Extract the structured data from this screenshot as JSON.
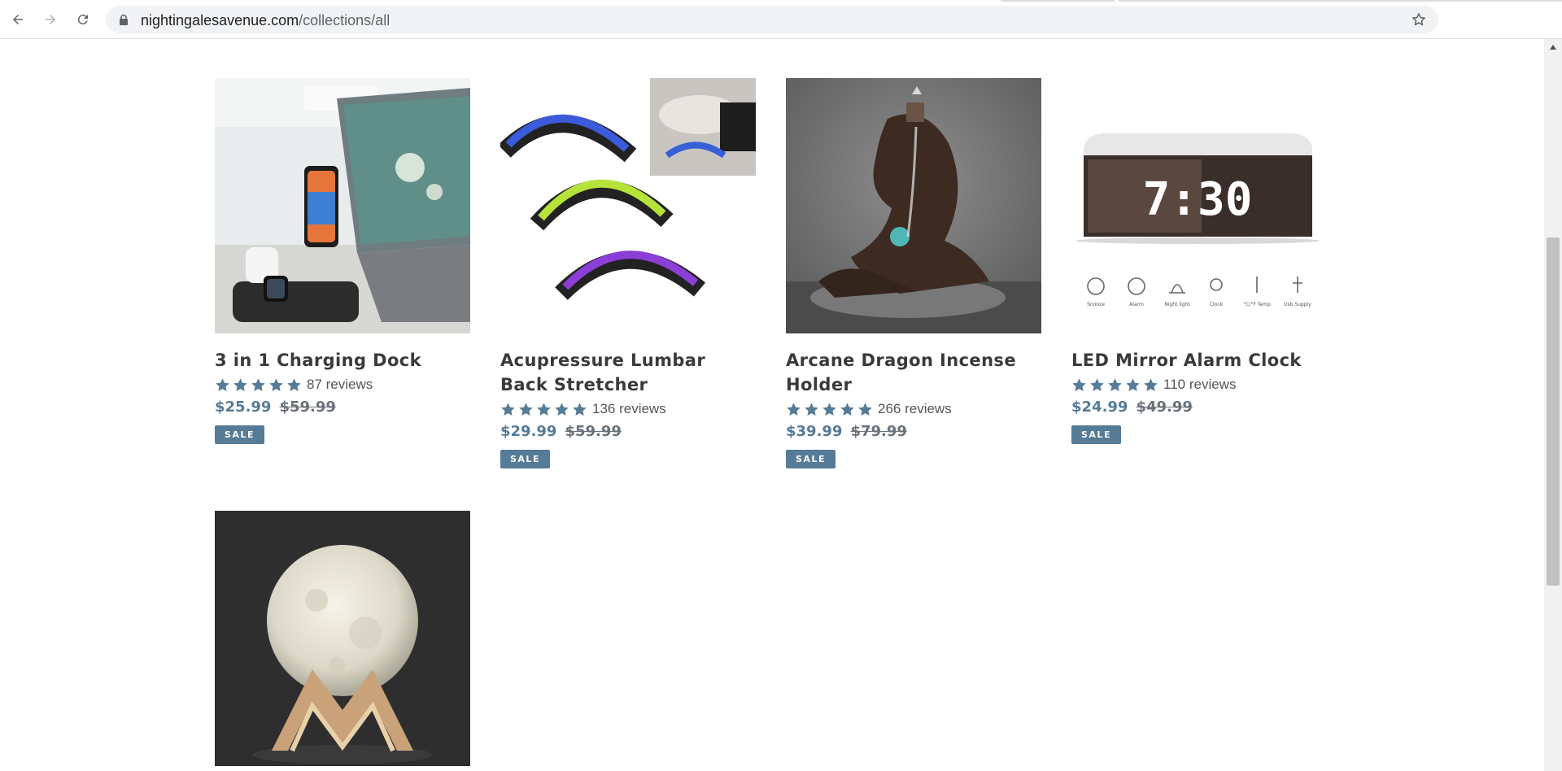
{
  "browser": {
    "url_domain": "nightingalesavenue.com",
    "url_path": "/collections/all"
  },
  "products": [
    {
      "title": "3 in 1 Charging Dock",
      "rating": 5,
      "reviews": "87 reviews",
      "sale_price": "$25.99",
      "original_price": "$59.99",
      "badge": "SALE"
    },
    {
      "title": "Acupressure Lumbar Back Stretcher",
      "rating": 5,
      "reviews": "136 reviews",
      "sale_price": "$29.99",
      "original_price": "$59.99",
      "badge": "SALE"
    },
    {
      "title": "Arcane Dragon Incense Holder",
      "rating": 5,
      "reviews": "266 reviews",
      "sale_price": "$39.99",
      "original_price": "$79.99",
      "badge": "SALE"
    },
    {
      "title": "LED Mirror Alarm Clock",
      "rating": 5,
      "reviews": "110 reviews",
      "sale_price": "$24.99",
      "original_price": "$49.99",
      "badge": "SALE"
    }
  ],
  "clock_image": {
    "display_time": "7:30",
    "feature_labels": [
      "Snooze",
      "Alarm",
      "Night light",
      "Clock",
      "°C/°F Temp",
      "Usb Supply"
    ]
  },
  "colors": {
    "accent": "#557b97",
    "star": "#557b97",
    "title": "#3a3a3a"
  }
}
